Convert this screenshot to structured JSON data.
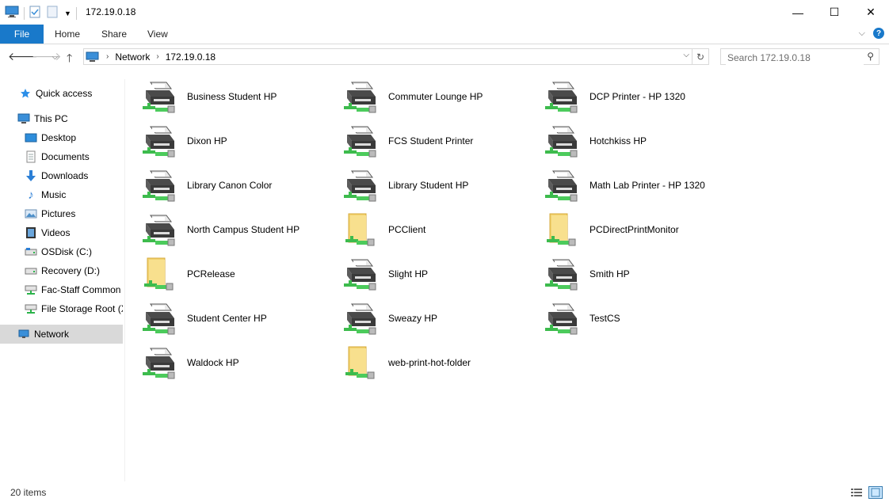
{
  "window": {
    "title": "172.19.0.18",
    "minimize": "—",
    "maximize": "☐",
    "close": "✕"
  },
  "ribbon": {
    "tabs": [
      "File",
      "Home",
      "Share",
      "View"
    ],
    "help": "?"
  },
  "nav": {
    "breadcrumbs": [
      "Network",
      "172.19.0.18"
    ],
    "search_placeholder": "Search 172.19.0.18"
  },
  "sidebar": {
    "items": [
      {
        "label": "Quick access",
        "icon": "star-icon"
      },
      {
        "label": "This PC",
        "icon": "computer-icon"
      },
      {
        "label": "Desktop",
        "icon": "desktop-icon"
      },
      {
        "label": "Documents",
        "icon": "documents-icon"
      },
      {
        "label": "Downloads",
        "icon": "download-icon"
      },
      {
        "label": "Music",
        "icon": "music-icon"
      },
      {
        "label": "Pictures",
        "icon": "pictures-icon"
      },
      {
        "label": "Videos",
        "icon": "videos-icon"
      },
      {
        "label": "OSDisk (C:)",
        "icon": "drive-icon"
      },
      {
        "label": "Recovery (D:)",
        "icon": "drive-icon"
      },
      {
        "label": "Fac-Staff Common",
        "icon": "network-drive-icon"
      },
      {
        "label": "File Storage Root (X",
        "icon": "network-drive-icon"
      },
      {
        "label": "Network",
        "icon": "network-icon",
        "selected": true
      }
    ]
  },
  "items": [
    {
      "name": "Business Student HP",
      "type": "printer"
    },
    {
      "name": "Commuter Lounge HP",
      "type": "printer"
    },
    {
      "name": "DCP Printer - HP 1320",
      "type": "printer"
    },
    {
      "name": "Dixon HP",
      "type": "printer"
    },
    {
      "name": "FCS Student Printer",
      "type": "printer"
    },
    {
      "name": "Hotchkiss HP",
      "type": "printer"
    },
    {
      "name": "Library Canon Color",
      "type": "printer"
    },
    {
      "name": "Library Student HP",
      "type": "printer"
    },
    {
      "name": "Math Lab Printer - HP 1320",
      "type": "printer"
    },
    {
      "name": "North Campus Student HP",
      "type": "printer"
    },
    {
      "name": "PCClient",
      "type": "folder"
    },
    {
      "name": "PCDirectPrintMonitor",
      "type": "folder"
    },
    {
      "name": "PCRelease",
      "type": "folder"
    },
    {
      "name": "Slight HP",
      "type": "printer"
    },
    {
      "name": "Smith HP",
      "type": "printer"
    },
    {
      "name": "Student Center HP",
      "type": "printer"
    },
    {
      "name": "Sweazy HP",
      "type": "printer"
    },
    {
      "name": "TestCS",
      "type": "printer"
    },
    {
      "name": "Waldock HP",
      "type": "printer"
    },
    {
      "name": "web-print-hot-folder",
      "type": "folder"
    }
  ],
  "status": {
    "count": "20 items"
  },
  "colors": {
    "accent": "#1979ca",
    "selection": "#d9d9d9"
  }
}
